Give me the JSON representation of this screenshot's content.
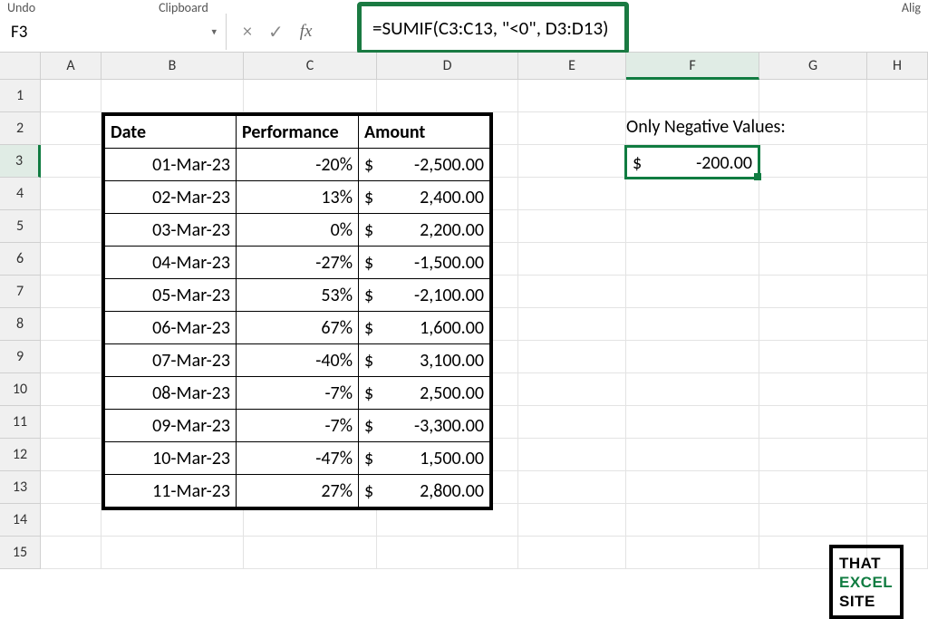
{
  "ribbon": {
    "undo": "Undo",
    "clipboard": "Clipboard",
    "align": "Alig"
  },
  "namebox": {
    "value": "F3"
  },
  "formula_bar": {
    "cancel": "×",
    "enter": "✓",
    "fx": "fx",
    "formula": "=SUMIF(C3:C13, \"<0\", D3:D13)"
  },
  "columns": [
    "A",
    "B",
    "C",
    "D",
    "E",
    "F",
    "G",
    "H"
  ],
  "rows": [
    "1",
    "2",
    "3",
    "4",
    "5",
    "6",
    "7",
    "8",
    "9",
    "10",
    "11",
    "12",
    "13",
    "14",
    "15"
  ],
  "active_col": "F",
  "active_row": "3",
  "table": {
    "headers": {
      "date": "Date",
      "performance": "Performance",
      "amount": "Amount"
    },
    "rows": [
      {
        "date": "01-Mar-23",
        "perf": "-20%",
        "amount": "-2,500.00"
      },
      {
        "date": "02-Mar-23",
        "perf": "13%",
        "amount": "2,400.00"
      },
      {
        "date": "03-Mar-23",
        "perf": "0%",
        "amount": "2,200.00"
      },
      {
        "date": "04-Mar-23",
        "perf": "-27%",
        "amount": "-1,500.00"
      },
      {
        "date": "05-Mar-23",
        "perf": "53%",
        "amount": "-2,100.00"
      },
      {
        "date": "06-Mar-23",
        "perf": "67%",
        "amount": "1,600.00"
      },
      {
        "date": "07-Mar-23",
        "perf": "-40%",
        "amount": "3,100.00"
      },
      {
        "date": "08-Mar-23",
        "perf": "-7%",
        "amount": "2,500.00"
      },
      {
        "date": "09-Mar-23",
        "perf": "-7%",
        "amount": "-3,300.00"
      },
      {
        "date": "10-Mar-23",
        "perf": "-47%",
        "amount": "1,500.00"
      },
      {
        "date": "11-Mar-23",
        "perf": "27%",
        "amount": "2,800.00"
      }
    ]
  },
  "currency_symbol": "$",
  "neg_label": "Only Negative Values:",
  "neg_result": "-200.00",
  "brand": {
    "w1": "THAT",
    "w2": "EXCEL",
    "w3": "SITE"
  }
}
